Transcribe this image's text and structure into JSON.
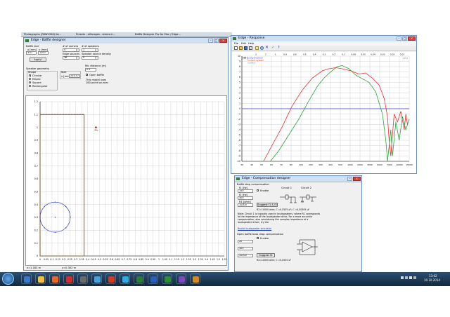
{
  "background_tabs": [
    "Photographs (R8W1356) Ko...",
    "Presets - allimages - stereo-h...",
    "Baffle Designer Pro for Mac / Edge..."
  ],
  "baffle_window": {
    "title": "Edge - Baffle designer",
    "baffle_size_label": "Baffle size",
    "x_label": "x [mm]",
    "y_label": "y [mm]",
    "x_value": "370",
    "y_value": "1100",
    "apply_label": "Apply!",
    "corners_label": "# of corners",
    "corners_value": "4",
    "speakers_label": "# of speakers",
    "speakers_value": "1",
    "edge_sources_label": "Edge sources",
    "edge_sources_value": "36",
    "source_density_label": "Speaker source density",
    "source_density_value": "0",
    "geometry_label": "Speaker geometry",
    "shape_label": "Shape",
    "shapes": [
      "Circular",
      "Elliptic",
      "Square",
      "Rectangular"
    ],
    "selected_shape": "Circular",
    "size_label": "Size",
    "size_field_label": "x [mm]",
    "size_value": "254.57",
    "mic_label": "Mic distance [m]",
    "mic_value": "2.3",
    "open_baffle_label": "Open baffle",
    "open_baffle_checked": true,
    "model_note_1": "This model uses",
    "model_note_2": "180 point sources",
    "mic_marker_label": "Mic",
    "y_ticks": [
      "1.2",
      "1.1",
      "1",
      "0.9",
      "0.8",
      "0.7",
      "0.6",
      "0.5",
      "0.4",
      "0.3",
      "0.2",
      "0.1",
      "0"
    ],
    "x_ticks": [
      "0",
      "0.05",
      "0.1",
      "0.15",
      "0.2",
      "0.25",
      "0.3",
      "0.35",
      "0.4",
      "0.45",
      "0.5",
      "0.55",
      "0.6",
      "0.65",
      "0.7",
      "0.75",
      "0.8",
      "0.85",
      "0.9",
      "0.95",
      "1",
      "1.05",
      "1.1",
      "1.15",
      "1.2",
      "1.25",
      "1.3",
      "1.35",
      "1.4",
      "1.45",
      "1.5",
      "1.55"
    ],
    "status_x": "x=1.003 m",
    "status_y": "y=0.302 m",
    "colors": {
      "baffle_red": "#d9403a",
      "baffle_green": "#3aa04a",
      "speaker": "#2a33c9",
      "mic": "#9b1c1c"
    }
  },
  "response_window": {
    "title": "Edge - Response",
    "menu": [
      "File",
      "Edit",
      "Help"
    ],
    "toolbar_icons": [
      "new-icon",
      "open-icon",
      "save-icon",
      "print-icon",
      "cursor-icon",
      "zoom-icon",
      "delete-icon",
      "check-icon",
      "info-icon"
    ],
    "db_label": "[dB]",
    "legend": [
      {
        "name": "Compensation",
        "color": "#3a3ad0"
      },
      {
        "name": "Current system",
        "color": "#e03030"
      },
      {
        "name": "Curve 1",
        "color": "#30a040"
      }
    ],
    "y_ticks": [
      "10",
      "9",
      "8",
      "7",
      "6",
      "5",
      "4",
      "3",
      "2",
      "1",
      "0",
      "-1",
      "-2",
      "-3",
      "-4",
      "-5",
      "-6",
      "-7",
      "-8",
      "-9",
      "-10"
    ],
    "x_ticks": [
      "30",
      "40",
      "50",
      "60",
      "70",
      "80",
      "100",
      "200",
      "300",
      "400",
      "500",
      "1000",
      "2000",
      "3000",
      "5000",
      "7000",
      "10000",
      "15000"
    ],
    "top_ticks": [
      "3",
      "2",
      "1",
      "0,8",
      "0,6",
      "0,5",
      "0,4",
      "0,3",
      "0,2",
      "0,1",
      "0,08",
      "0,05",
      "0,04",
      "0,03",
      "0,02",
      "0,01"
    ],
    "top_right": "1 E-2"
  },
  "comp_window": {
    "title": "Edge - Compensation designer",
    "baffle_step_label": "Baffle step compensation",
    "f1_label": "f1 [Hz]",
    "f1_value": "150",
    "enable_label": "Enable",
    "f2_label": "f2 [Hz]",
    "f2_value": "300",
    "r1_label": "R1 [ohm]",
    "r1_value": "10000",
    "suggest_label": "Suggest f1 & f2",
    "circuit1_label": "Circuit 1",
    "circuit2_label": "Circuit 2",
    "formula": "R2=10000 ohm; C =0,0535 uF; C =0,00305 uF",
    "note": "Note: Circuit 1 is typically used in loudspeakers, where R1 corresponds to the impedance of the loudspeaker drive. For a more accurate compensation, also considering the complex impedance of a loudspeaker driver, try the",
    "note_link": "Baxtal loudspeaker simulator",
    "open_baffle_label": "Open baffle bass drop compensation",
    "ob_f1_value": "20",
    "ob_enable_label": "Enable",
    "ob_f2_value": "300",
    "ob_r1_value": "10000",
    "ob_suggest_label": "Suggest f2",
    "ob_formula": "R2=10000 ohm; C =0,0535 uF"
  },
  "taskbar": {
    "time": "13:02",
    "date": "10.10.2014",
    "apps": [
      "start-icon",
      "ie-icon",
      "explorer-icon",
      "firefox-icon",
      "media-icon",
      "terminal-icon",
      "chrome-icon",
      "edge-app-icon",
      "skype-icon",
      "photo-icon",
      "word-icon",
      "excel-icon",
      "misc-icon",
      "app-icon"
    ]
  }
}
